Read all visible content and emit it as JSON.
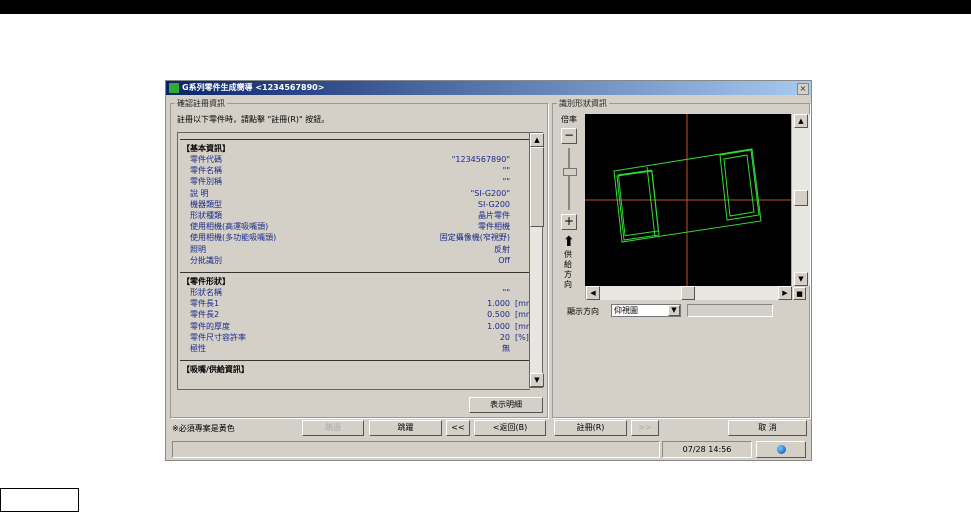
{
  "window": {
    "title": "G系列零件生成嚮導 <1234567890>"
  },
  "left_panel": {
    "group_label": "確認註冊資訊",
    "instruction": "註冊以下零件時，請點擊 \"註冊(R)\" 按鈕。",
    "sections": [
      {
        "title": "【基本資訊】",
        "rows": [
          {
            "label": "零件代碼",
            "value": "\"1234567890\"",
            "unit": ""
          },
          {
            "label": "零件名稱",
            "value": "\"\"",
            "unit": ""
          },
          {
            "label": "零件別稱",
            "value": "\"\"",
            "unit": ""
          },
          {
            "label": "說 明",
            "value": "\"SI-G200\"",
            "unit": ""
          },
          {
            "label": "機器類型",
            "value": "SI-G200",
            "unit": ""
          },
          {
            "label": "形狀種類",
            "value": "晶片零件",
            "unit": ""
          },
          {
            "label": "使用相機(高運吸嘴頭)",
            "value": "零件相機",
            "unit": ""
          },
          {
            "label": "使用相機(多功能吸嘴頭)",
            "value": "固定攝像機(窄視野)",
            "unit": ""
          },
          {
            "label": "照明",
            "value": "反射",
            "unit": ""
          },
          {
            "label": "分批識別",
            "value": "Off",
            "unit": ""
          }
        ]
      },
      {
        "title": "【零件形狀】",
        "rows": [
          {
            "label": "形狀名稱",
            "value": "\"\"",
            "unit": ""
          },
          {
            "label": "零件長1",
            "value": "1.000",
            "unit": "[mm]"
          },
          {
            "label": "零件長2",
            "value": "0.500",
            "unit": "[mm]"
          },
          {
            "label": "零件的厚度",
            "value": "1.000",
            "unit": "[mm]"
          },
          {
            "label": "零件尺寸容許率",
            "value": "20",
            "unit": "[%]"
          },
          {
            "label": "極性",
            "value": "無",
            "unit": ""
          }
        ]
      },
      {
        "title": "【吸嘴/供給資訊】",
        "rows": []
      }
    ],
    "detail_button": "表示明細"
  },
  "right_panel": {
    "group_label": "識別形狀資訊",
    "zoom_label": "倍率",
    "feed_direction_label": "供給方向",
    "view_direction_label": "顯示方向",
    "view_direction_value": "仰視圖"
  },
  "footer": {
    "note": "※必須專案是黃色",
    "buttons": {
      "skip": "跳過",
      "jump": "跳躍",
      "first": "<<",
      "back": "<返回(B)",
      "register": "註冊(R)",
      "next": ">>",
      "cancel": "取 消"
    },
    "status_time": "07/28 14:56"
  },
  "colors": {
    "title_start": "#0a246a",
    "label_blue": "#1a2a8a",
    "shape_green": "#33dd33",
    "crosshair": "#c0502a"
  }
}
